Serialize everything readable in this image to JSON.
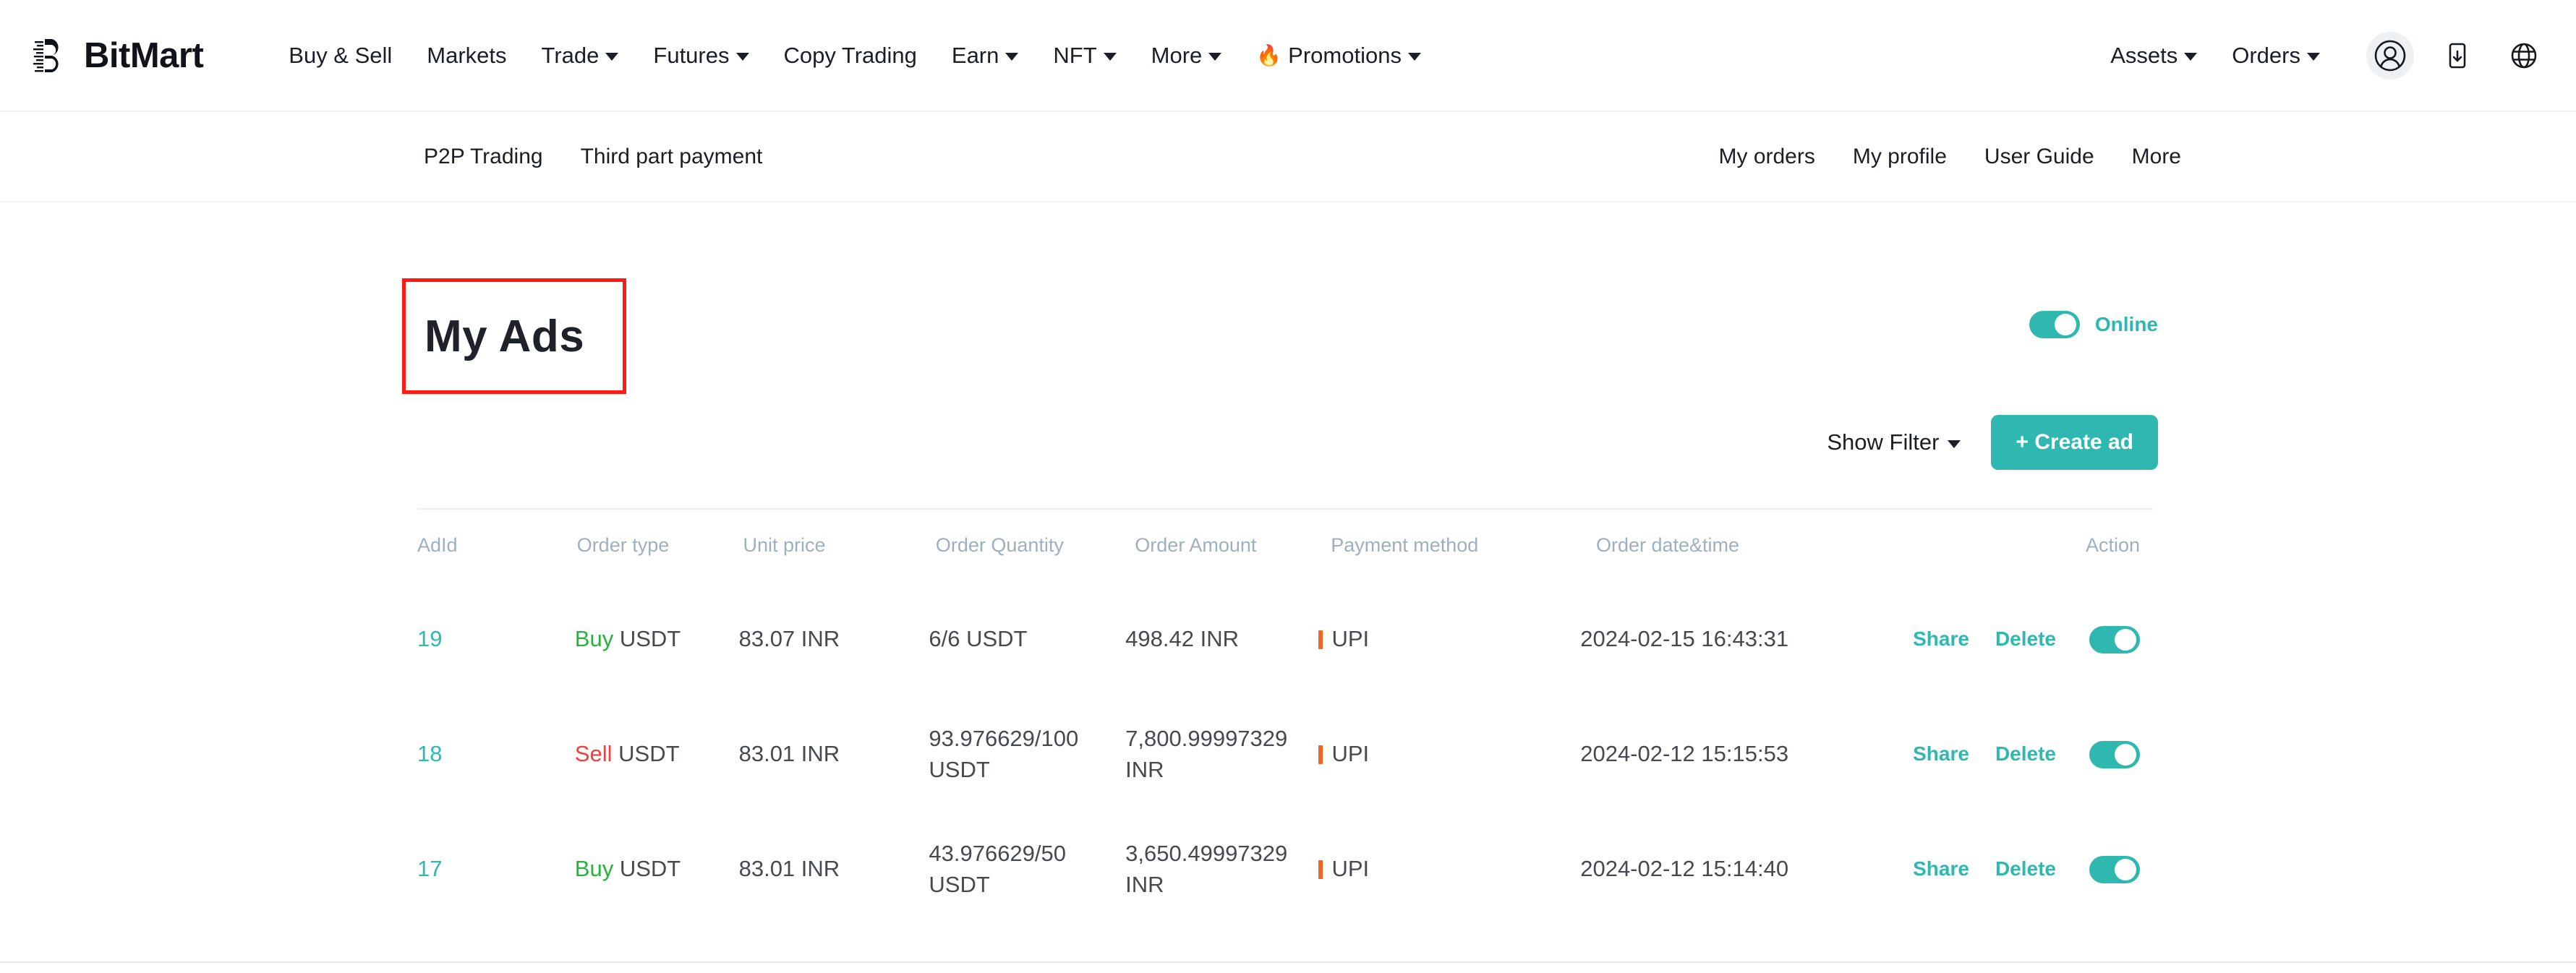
{
  "brand": {
    "name": "BitMart",
    "logo_icon": "bitmart-logo-icon"
  },
  "topnav": {
    "items": [
      {
        "label": "Buy & Sell",
        "caret": false
      },
      {
        "label": "Markets",
        "caret": false
      },
      {
        "label": "Trade",
        "caret": true
      },
      {
        "label": "Futures",
        "caret": true
      },
      {
        "label": "Copy Trading",
        "caret": false
      },
      {
        "label": "Earn",
        "caret": true
      },
      {
        "label": "NFT",
        "caret": true
      },
      {
        "label": "More",
        "caret": true
      },
      {
        "label": "Promotions",
        "caret": true,
        "icon": "fire-icon",
        "glyph": "🔥"
      }
    ],
    "right": [
      {
        "label": "Assets",
        "caret": true
      },
      {
        "label": "Orders",
        "caret": true
      }
    ],
    "icons": [
      {
        "name": "user-avatar-icon"
      },
      {
        "name": "mobile-download-icon"
      },
      {
        "name": "globe-language-icon"
      }
    ]
  },
  "subnav": {
    "left": [
      {
        "label": "P2P Trading"
      },
      {
        "label": "Third part payment"
      }
    ],
    "right": [
      {
        "label": "My orders"
      },
      {
        "label": "My profile"
      },
      {
        "label": "User Guide"
      },
      {
        "label": "More"
      }
    ]
  },
  "main": {
    "title": "My Ads",
    "online_toggle": {
      "label": "Online",
      "state": "on"
    },
    "show_filter_label": "Show Filter",
    "create_ad_label": "+ Create ad"
  },
  "table": {
    "columns": [
      "AdId",
      "Order type",
      "Unit price",
      "Order Quantity",
      "Order Amount",
      "Payment method",
      "Order date&time",
      "Action"
    ],
    "rows": [
      {
        "adid": "19",
        "side": "Buy",
        "side_kind": "buy",
        "asset": "USDT",
        "unit_price": "83.07 INR",
        "order_quantity": "6/6 USDT",
        "order_amount": "498.42 INR",
        "payment_method": "UPI",
        "order_datetime": "2024-02-15 16:43:31",
        "share_label": "Share",
        "delete_label": "Delete",
        "toggle_state": "on"
      },
      {
        "adid": "18",
        "side": "Sell",
        "side_kind": "sell",
        "asset": "USDT",
        "unit_price": "83.01 INR",
        "order_quantity": "93.976629/100 USDT",
        "order_amount": "7,800.99997329 INR",
        "payment_method": "UPI",
        "order_datetime": "2024-02-12 15:15:53",
        "share_label": "Share",
        "delete_label": "Delete",
        "toggle_state": "on"
      },
      {
        "adid": "17",
        "side": "Buy",
        "side_kind": "buy",
        "asset": "USDT",
        "unit_price": "83.01 INR",
        "order_quantity": "43.976629/50 USDT",
        "order_amount": "3,650.49997329 INR",
        "payment_method": "UPI",
        "order_datetime": "2024-02-12 15:14:40",
        "share_label": "Share",
        "delete_label": "Delete",
        "toggle_state": "on"
      }
    ]
  },
  "colors": {
    "accent_teal": "#2eb8b0",
    "buy_green": "#23b53a",
    "sell_red": "#fb3b3b",
    "payment_marker_orange": "#f26522",
    "highlight_box_red": "#ff1a12",
    "header_text_gray": "#9fb0bd"
  }
}
